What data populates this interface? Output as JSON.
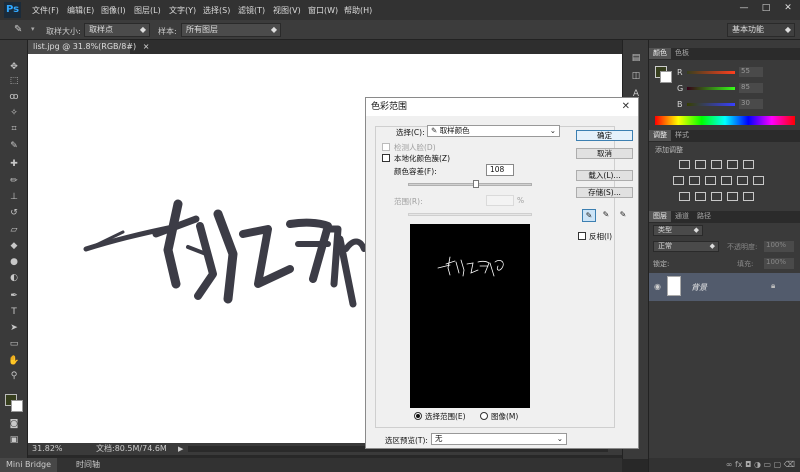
{
  "app": {
    "logo": "Ps"
  },
  "menu": [
    "文件(F)",
    "编辑(E)",
    "图像(I)",
    "图层(L)",
    "文字(Y)",
    "选择(S)",
    "滤镜(T)",
    "视图(V)",
    "窗口(W)",
    "帮助(H)"
  ],
  "window_controls": {
    "minimize": "—",
    "maximize": "□",
    "close": "✕"
  },
  "options_bar": {
    "sample_size_label": "取样大小:",
    "sample_size_value": "取样点",
    "sample_label": "样本:",
    "sample_value": "所有图层",
    "workspace": "基本功能"
  },
  "document": {
    "tab_title": "list.jpg @ 31.8%(RGB/8#)",
    "tab_close": "×",
    "zoom": "31.82%",
    "doc_info": "文档:80.5M/74.6M"
  },
  "bottom_tabs": [
    "Mini Bridge",
    "时间轴"
  ],
  "panels": {
    "color_tabs": [
      "颜色",
      "色板"
    ],
    "rgb": [
      {
        "label": "R",
        "value": "55"
      },
      {
        "label": "G",
        "value": "85"
      },
      {
        "label": "B",
        "value": "30"
      }
    ],
    "adjust_tabs": [
      "调整",
      "样式"
    ],
    "adjust_title": "添加调整",
    "layers_tabs": [
      "图层",
      "通道",
      "路径"
    ],
    "layer_kind": "类型",
    "blend_mode": "正常",
    "opacity_label": "不透明度:",
    "opacity_value": "100%",
    "lock_label": "锁定:",
    "fill_label": "填充:",
    "fill_value": "100%",
    "layer_name": "背景",
    "colors": {
      "fg": "#373f1e",
      "bg": "#ffffff"
    }
  },
  "dialog": {
    "title": "色彩范围",
    "close": "✕",
    "select_label": "选择(C):",
    "select_value": "取样颜色",
    "detect_faces": "检测人脸(D)",
    "localized": "本地化颜色簇(Z)",
    "fuzziness_label": "颜色容差(F):",
    "fuzziness_value": "108",
    "fuzziness": 0.54,
    "range_label": "范围(R):",
    "range_unit": "%",
    "buttons": {
      "ok": "确定",
      "cancel": "取消",
      "load": "载入(L)...",
      "save": "存储(S)..."
    },
    "invert": "反相(I)",
    "radio_selection": "选择范围(E)",
    "radio_image": "图像(M)",
    "preview_label": "选区预览(T):",
    "preview_value": "无"
  }
}
